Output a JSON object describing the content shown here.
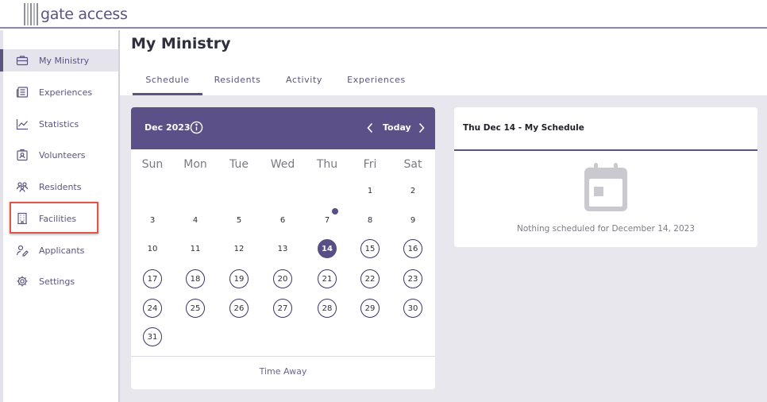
{
  "app": {
    "logo_text": "gate access"
  },
  "sidebar": {
    "items": [
      {
        "label": "My Ministry",
        "icon": "briefcase-icon",
        "active": true
      },
      {
        "label": "Experiences",
        "icon": "newspaper-icon"
      },
      {
        "label": "Statistics",
        "icon": "chart-line-icon"
      },
      {
        "label": "Volunteers",
        "icon": "id-badge-icon"
      },
      {
        "label": "Residents",
        "icon": "people-icon"
      },
      {
        "label": "Facilities",
        "icon": "building-icon"
      },
      {
        "label": "Applicants",
        "icon": "user-pen-icon"
      },
      {
        "label": "Settings",
        "icon": "gear-icon"
      }
    ]
  },
  "main": {
    "title": "My Ministry",
    "tabs": [
      {
        "label": "Schedule",
        "active": true
      },
      {
        "label": "Residents"
      },
      {
        "label": "Activity"
      },
      {
        "label": "Experiences"
      }
    ]
  },
  "calendar": {
    "month_label": "Dec 2023",
    "today_label": "Today",
    "weekdays": [
      "Sun",
      "Mon",
      "Tue",
      "Wed",
      "Thu",
      "Fri",
      "Sat"
    ],
    "days": [
      "1",
      "2",
      "3",
      "4",
      "5",
      "6",
      "7",
      "8",
      "9",
      "10",
      "11",
      "12",
      "13",
      "14",
      "15",
      "16",
      "17",
      "18",
      "19",
      "20",
      "21",
      "22",
      "23",
      "24",
      "25",
      "26",
      "27",
      "28",
      "29",
      "30",
      "31"
    ],
    "selected_day": "14",
    "event_day": "7",
    "time_away_label": "Time Away"
  },
  "schedule": {
    "title": "Thu Dec 14 - My Schedule",
    "empty_text": "Nothing scheduled for December 14, 2023",
    "icon": "calendar-icon"
  },
  "colors": {
    "primary": "#5b5188",
    "accent_highlight": "#e0574a",
    "background": "#e8e7ee"
  }
}
